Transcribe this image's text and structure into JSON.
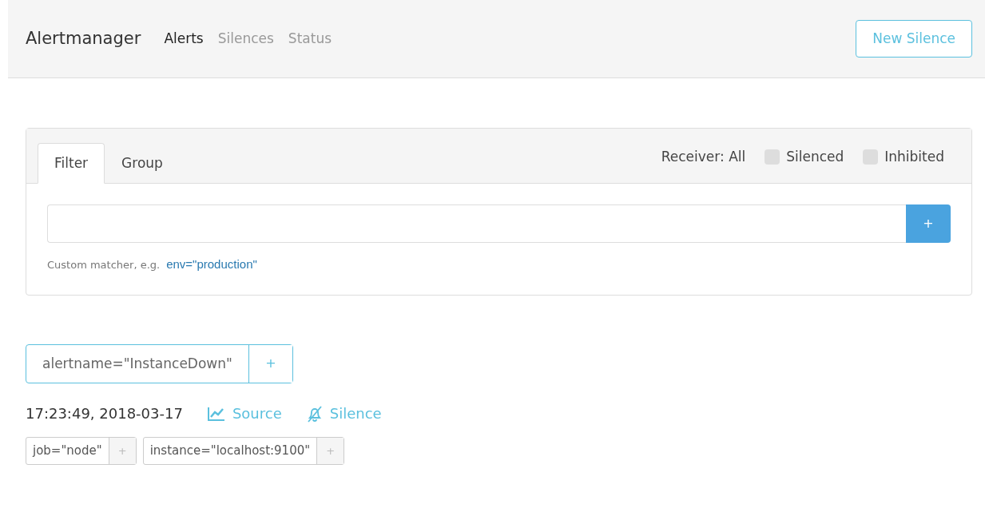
{
  "navbar": {
    "brand": "Alertmanager",
    "links": [
      {
        "label": "Alerts",
        "selected": true
      },
      {
        "label": "Silences",
        "selected": false
      },
      {
        "label": "Status",
        "selected": false
      }
    ],
    "action_button": "New Silence"
  },
  "filter_panel": {
    "tabs": [
      {
        "label": "Filter",
        "selected": true
      },
      {
        "label": "Group",
        "selected": false
      }
    ],
    "receiver": "Receiver: All",
    "checkboxes": [
      {
        "label": "Silenced",
        "checked": false
      },
      {
        "label": "Inhibited",
        "checked": false
      }
    ],
    "add_button": "+",
    "hint": "Custom matcher, e.g.",
    "example": "env=\"production\""
  },
  "group": {
    "label": "alertname=\"InstanceDown\"",
    "add": "+",
    "alerts": [
      {
        "time": "17:23:49, 2018-03-17",
        "source": "Source",
        "silence": "Silence",
        "labels": [
          {
            "text": "job=\"node\"",
            "add": "+"
          },
          {
            "text": "instance=\"localhost:9100\"",
            "add": "+"
          }
        ]
      }
    ]
  }
}
